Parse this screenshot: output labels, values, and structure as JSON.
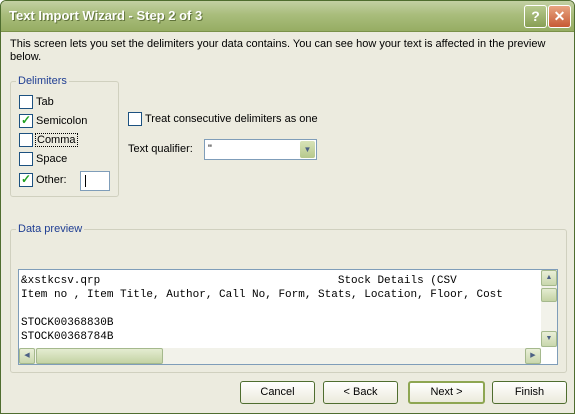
{
  "window": {
    "title": "Text Import Wizard - Step 2 of 3"
  },
  "description": "This screen lets you set the delimiters your data contains.  You can see how your text is affected in the preview below.",
  "delimiters": {
    "legend": "Delimiters",
    "options": [
      {
        "label": "Tab",
        "checked": false
      },
      {
        "label": "Semicolon",
        "checked": true
      },
      {
        "label": "Comma",
        "checked": false
      },
      {
        "label": "Space",
        "checked": false
      },
      {
        "label": "Other:",
        "checked": true
      }
    ],
    "other_value": ""
  },
  "consecutive": {
    "label": "Treat consecutive delimiters as one",
    "checked": false
  },
  "qualifier": {
    "label": "Text qualifier:",
    "value": "\""
  },
  "preview": {
    "legend": "Data preview",
    "lines": [
      "&xstkcsv.qrp                                    Stock Details (CSV",
      "Item no , Item Title, Author, Call No, Form, Stats, Location, Floor, Cost",
      "",
      "STOCK00368830B",
      "STOCK00368784B"
    ]
  },
  "buttons": {
    "cancel": "Cancel",
    "back": "< Back",
    "next": "Next >",
    "finish": "Finish"
  },
  "icons": {
    "help": "help-icon",
    "close": "close-icon"
  }
}
